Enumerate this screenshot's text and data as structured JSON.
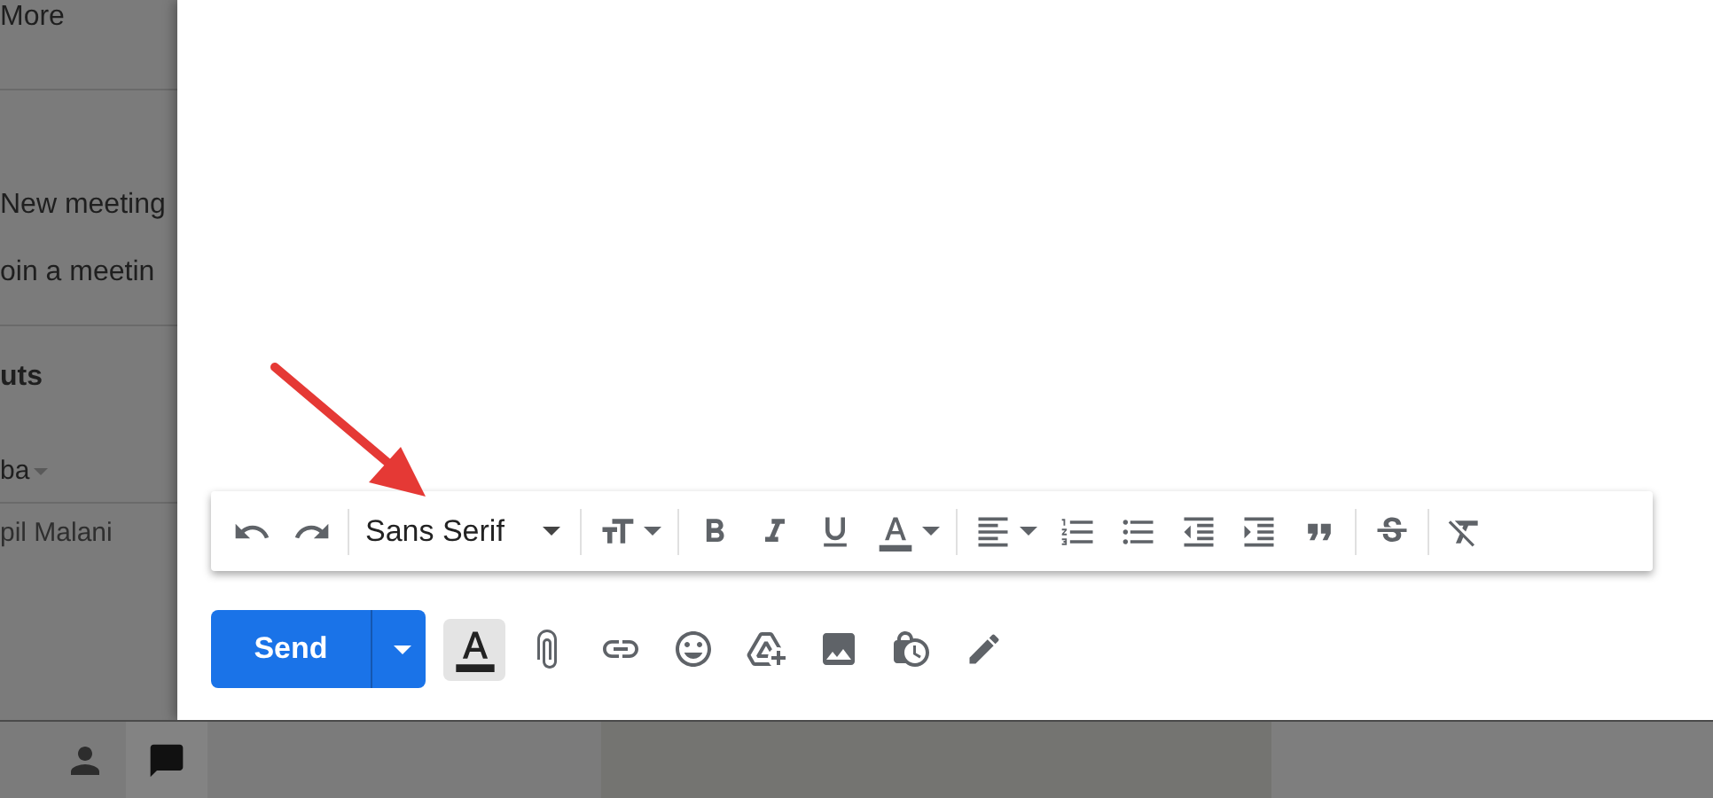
{
  "sidebar": {
    "more_link": "More",
    "meet": {
      "items": [
        "New meeting",
        "oin a meetin"
      ]
    },
    "hangouts": {
      "heading": "uts",
      "account": "ba",
      "contact": "pil Malani"
    }
  },
  "toolbar": {
    "font": "Sans Serif"
  },
  "compose": {
    "send": "Send",
    "formatting_toggle": {
      "selected": true
    }
  }
}
